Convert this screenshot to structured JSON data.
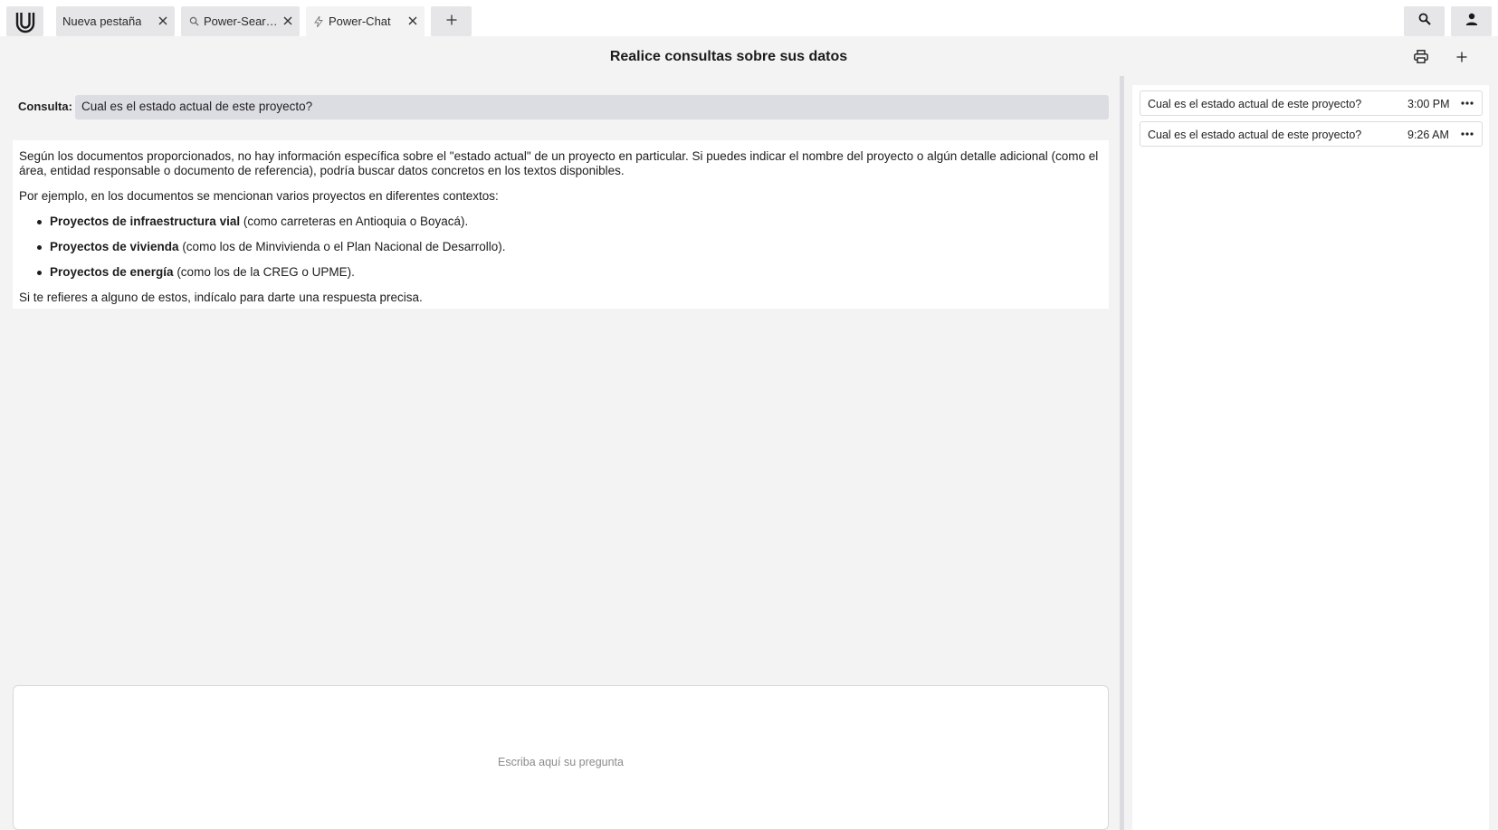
{
  "tabs": [
    {
      "label": "Nueva pestaña",
      "icon": "none"
    },
    {
      "label": "Power-Search...",
      "icon": "search-icon"
    },
    {
      "label": "Power-Chat",
      "icon": "bolt-icon"
    }
  ],
  "header": {
    "title": "Realice consultas sobre sus datos"
  },
  "query": {
    "label": "Consulta:",
    "value": "Cual es el estado actual de este proyecto?"
  },
  "answer": {
    "para1": "Según los documentos proporcionados, no hay información específica sobre el \"estado actual\" de un proyecto en particular. Si puedes indicar el nombre del proyecto o algún detalle adicional (como el área, entidad responsable o documento de referencia), podría buscar datos concretos en los textos disponibles.",
    "para2": "Por ejemplo, en los documentos se mencionan varios proyectos en diferentes contextos:",
    "bullets": [
      {
        "bold": "Proyectos de infraestructura vial",
        "rest": " (como carreteras en Antioquia o Boyacá)."
      },
      {
        "bold": "Proyectos de vivienda",
        "rest": " (como los de Minvivienda o el Plan Nacional de Desarrollo)."
      },
      {
        "bold": "Proyectos de energía",
        "rest": " (como los de la CREG o UPME)."
      }
    ],
    "para3": "Si te refieres a alguno de estos, indícalo para darte una respuesta precisa."
  },
  "input": {
    "placeholder": "Escriba aquí su pregunta"
  },
  "history": [
    {
      "question": "Cual es el estado actual de este proyecto?",
      "time": "3:00 PM"
    },
    {
      "question": "Cual es el estado actual de este proyecto?",
      "time": "9:26 AM"
    }
  ],
  "colors": {
    "background": "#f3f3f4",
    "tab": "#e6e6e9",
    "query_box": "#dcdce3",
    "panel": "#ffffff"
  }
}
